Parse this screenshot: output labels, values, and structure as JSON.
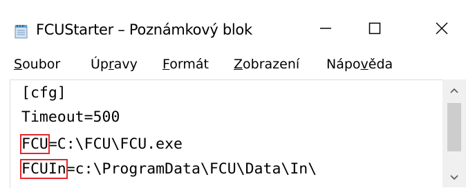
{
  "window": {
    "title": "FCUStarter – Poznámkový blok",
    "app_icon": "notepad-icon",
    "controls": {
      "minimize_icon": "minimize-icon",
      "maximize_icon": "maximize-icon",
      "close_icon": "close-icon"
    }
  },
  "menu": {
    "items": [
      {
        "label": "Soubor",
        "accel": "S",
        "rest": "oubor"
      },
      {
        "label": "Úpravy",
        "pre": "Úp",
        "accel": "r",
        "rest": "avy"
      },
      {
        "label": "Formát",
        "accel": "F",
        "rest": "ormát"
      },
      {
        "label": "Zobrazení",
        "accel": "Z",
        "rest": "obrazení"
      },
      {
        "label": "Nápověda",
        "pre": "Nápo",
        "accel": "v",
        "rest": "ěda"
      }
    ]
  },
  "editor": {
    "lines": [
      {
        "text": "[cfg]"
      },
      {
        "text": "Timeout=500"
      },
      {
        "key": "FCU",
        "rest": "=C:\\FCU\\FCU.exe"
      },
      {
        "key": "FCUIn",
        "rest": "=c:\\ProgramData\\FCU\\Data\\In\\"
      }
    ],
    "highlight_color": "#e6262a"
  },
  "scrollbar": {
    "up_icon": "scroll-up-arrow-icon",
    "down_icon": "scroll-down-arrow-icon"
  }
}
